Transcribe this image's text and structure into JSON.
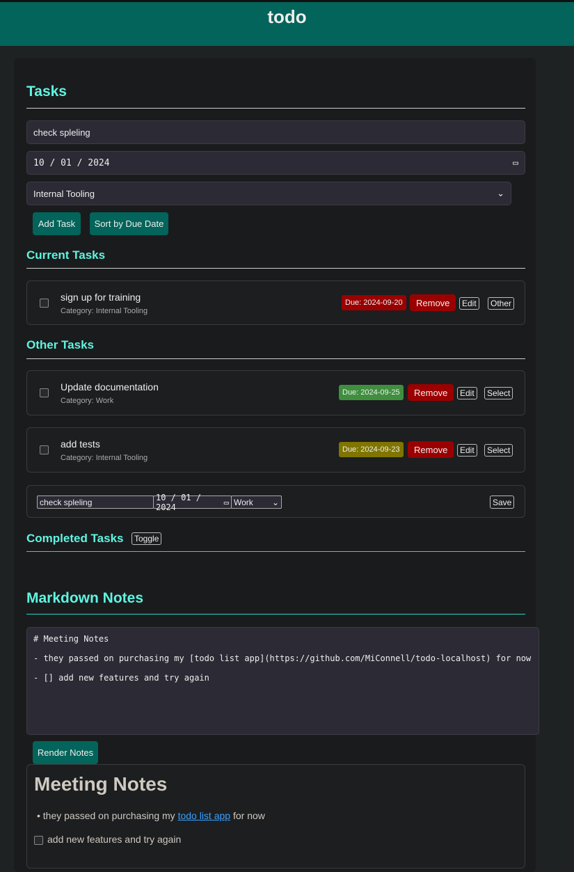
{
  "header": {
    "title": "todo"
  },
  "tasks": {
    "heading": "Tasks",
    "task_input": "check spleling",
    "date_input": "10 / 01 / 2024",
    "category_select": "Internal Tooling",
    "add_label": "Add Task",
    "sort_label": "Sort by Due Date"
  },
  "current": {
    "heading": "Current Tasks",
    "items": [
      {
        "title": "sign up for training",
        "category": "Category: Internal Tooling",
        "due": "Due: 2024-09-20",
        "due_color": "#9b0000",
        "remove": "Remove",
        "edit": "Edit",
        "action": "Other"
      }
    ]
  },
  "other": {
    "heading": "Other Tasks",
    "items": [
      {
        "title": "Update documentation",
        "category": "Category: Work",
        "due": "Due: 2024-09-25",
        "due_color": "#3f8f3f",
        "remove": "Remove",
        "edit": "Edit",
        "action": "Select"
      },
      {
        "title": "add tests",
        "category": "Category: Internal Tooling",
        "due": "Due: 2024-09-23",
        "due_color": "#7f7500",
        "remove": "Remove",
        "edit": "Edit",
        "action": "Select"
      }
    ]
  },
  "edit_row": {
    "text": "check spleling",
    "date": "10 / 01 / 2024",
    "category": "Work",
    "save": "Save"
  },
  "completed": {
    "heading": "Completed Tasks",
    "toggle": "Toggle"
  },
  "notes": {
    "heading": "Markdown Notes",
    "lines": [
      "# Meeting Notes",
      "- they passed on purchasing my [todo list app](https://github.com/MiConnell/todo-localhost) for now",
      "- [] add new features and try again"
    ],
    "render_label": "Render Notes",
    "rendered": {
      "h1": "Meeting Notes",
      "bullet_pre": "they passed on purchasing my ",
      "link": "todo list app",
      "bullet_post": " for now",
      "checkbox_item": "add new features and try again"
    }
  }
}
